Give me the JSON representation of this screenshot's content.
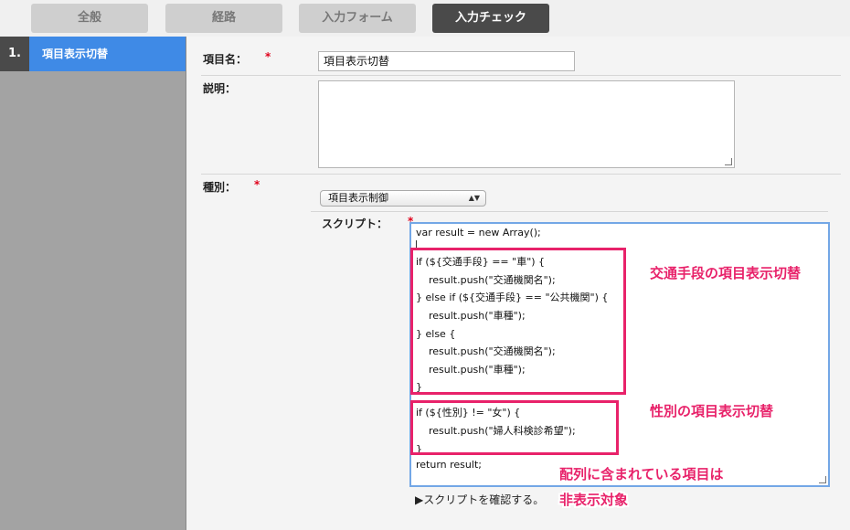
{
  "tabs": [
    {
      "label": "全般"
    },
    {
      "label": "経路"
    },
    {
      "label": "入力フォーム"
    },
    {
      "label": "入力チェック"
    }
  ],
  "sidebar": {
    "items": [
      {
        "number": "1.",
        "label": "項目表示切替"
      }
    ]
  },
  "form": {
    "item_name_label": "項目名：",
    "item_name_value": "項目表示切替",
    "description_label": "説明：",
    "type_label": "種別：",
    "type_value": "項目表示制御",
    "script_label": "スクリプト：",
    "required_mark": "*"
  },
  "script": {
    "lines": [
      "var result = new Array();",
      "if (${交通手段} == \"車\") {",
      "    result.push(\"交通機関名\");",
      "} else if (${交通手段} == \"公共機関\") {",
      "    result.push(\"車種\");",
      "} else {",
      "    result.push(\"交通機関名\");",
      "    result.push(\"車種\");",
      "}",
      "if (${性別} != \"女\") {",
      "    result.push(\"婦人科検診希望\");",
      "}",
      "return result;"
    ]
  },
  "confirm_link": "▶スクリプトを確認する。",
  "annotations": {
    "box1": "交通手段の項目表示切替",
    "box2": "性別の項目表示切替",
    "note_line1": "配列に含まれている項目は",
    "note_line2": "非表示対象"
  },
  "colors": {
    "accent": "#3f8ae6",
    "tab_active": "#4a4a4a",
    "annotation": "#e8226a",
    "required": "#e0001b"
  }
}
